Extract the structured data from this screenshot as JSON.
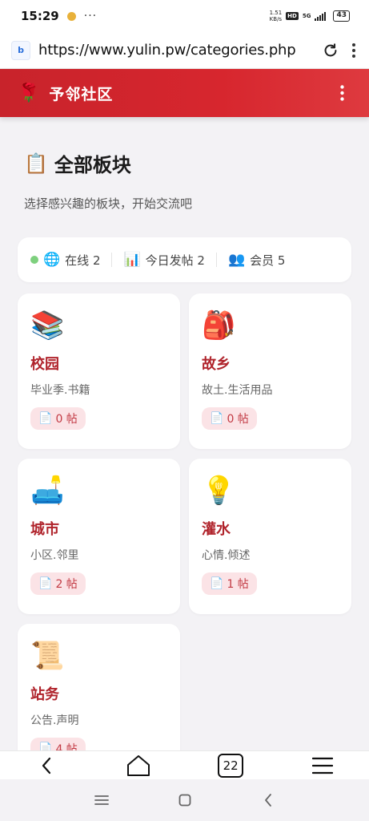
{
  "status_bar": {
    "time": "15:29",
    "more": "···",
    "speed_value": "1.51",
    "speed_unit": "KB/s",
    "hd": "HD",
    "network": "5G",
    "battery": "43"
  },
  "browser": {
    "url": "https://www.yulin.pw/categories.php",
    "site_icon": "b",
    "tab_count": "22"
  },
  "header": {
    "logo": "🌹",
    "title": "予邻社区"
  },
  "page": {
    "title_icon": "📋",
    "title": "全部板块",
    "subtitle": "选择感兴趣的板块，开始交流吧"
  },
  "stats": {
    "online_icon": "🌐",
    "online": "在线 2",
    "today_icon": "📊",
    "today": "今日发帖 2",
    "members_icon": "👥",
    "members": "会员 5",
    "online_dot_color": "#7ed07e"
  },
  "boards": [
    {
      "emoji": "📚",
      "title": "校园",
      "desc": "毕业季.书籍",
      "posts": "0 帖"
    },
    {
      "emoji": "🎒",
      "title": "故乡",
      "desc": "故土.生活用品",
      "posts": "0 帖"
    },
    {
      "emoji": "🛋️",
      "title": "城市",
      "desc": "小区.邻里",
      "posts": "2 帖"
    },
    {
      "emoji": "💡",
      "title": "灌水",
      "desc": "心情.倾述",
      "posts": "1 帖"
    },
    {
      "emoji": "📜",
      "title": "站务",
      "desc": "公告.声明",
      "posts": "4 帖"
    }
  ],
  "doc_icon": "📄",
  "colors": {
    "brand": "#d7262e",
    "board_title": "#b0242c",
    "badge_bg": "#fbe3e6"
  }
}
